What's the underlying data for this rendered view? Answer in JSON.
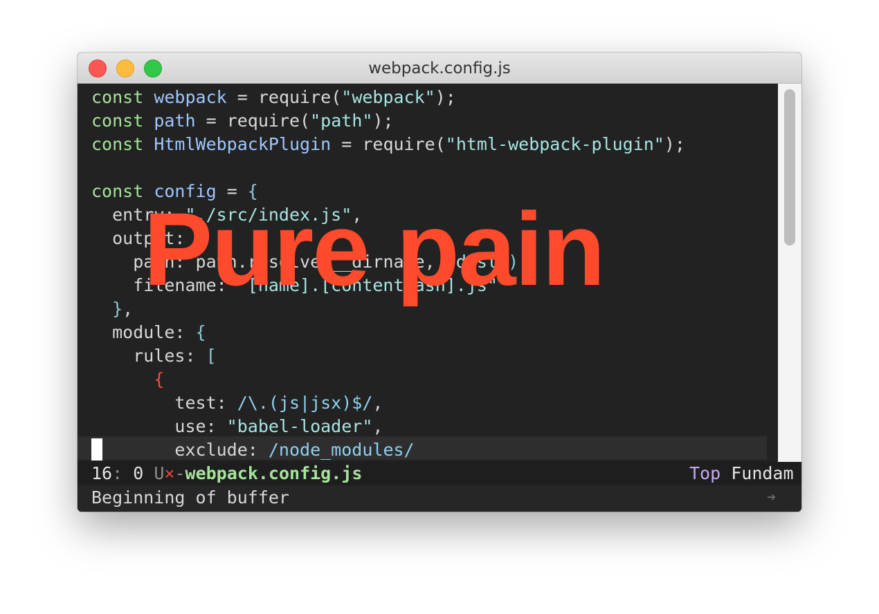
{
  "window": {
    "title": "webpack.config.js"
  },
  "editor": {
    "lines": [
      [
        {
          "t": "const",
          "c": "kw"
        },
        {
          "t": " "
        },
        {
          "t": "webpack",
          "c": "var"
        },
        {
          "t": " = require("
        },
        {
          "t": "\"webpack\"",
          "c": "str"
        },
        {
          "t": ");"
        }
      ],
      [
        {
          "t": "const",
          "c": "kw"
        },
        {
          "t": " "
        },
        {
          "t": "path",
          "c": "var"
        },
        {
          "t": " = require("
        },
        {
          "t": "\"path\"",
          "c": "str"
        },
        {
          "t": ");"
        }
      ],
      [
        {
          "t": "const",
          "c": "kw"
        },
        {
          "t": " "
        },
        {
          "t": "HtmlWebpackPlugin",
          "c": "var"
        },
        {
          "t": " = require("
        },
        {
          "t": "\"html-webpack-plugin\"",
          "c": "str"
        },
        {
          "t": ");"
        }
      ],
      [],
      [
        {
          "t": "const",
          "c": "kw"
        },
        {
          "t": " "
        },
        {
          "t": "config",
          "c": "var"
        },
        {
          "t": " = "
        },
        {
          "t": "{",
          "c": "br"
        }
      ],
      [
        {
          "t": "  entry: "
        },
        {
          "t": "\"./src/index.js\"",
          "c": "str"
        },
        {
          "t": ","
        }
      ],
      [
        {
          "t": "  output: "
        },
        {
          "t": "{",
          "c": "br"
        }
      ],
      [
        {
          "t": "    path: path.resolve"
        },
        {
          "t": "(",
          "c": "br"
        },
        {
          "t": "__dirname, "
        },
        {
          "t": "\"dist\"",
          "c": "str"
        },
        {
          "t": ")",
          "c": "br"
        },
        {
          "t": ","
        }
      ],
      [
        {
          "t": "    filename: "
        },
        {
          "t": "\"[name].[contenthash].js\"",
          "c": "str"
        }
      ],
      [
        {
          "t": "  "
        },
        {
          "t": "}",
          "c": "br"
        },
        {
          "t": ","
        }
      ],
      [
        {
          "t": "  module: "
        },
        {
          "t": "{",
          "c": "br"
        }
      ],
      [
        {
          "t": "    rules: "
        },
        {
          "t": "[",
          "c": "br"
        }
      ],
      [
        {
          "t": "      "
        },
        {
          "t": "{",
          "c": "rb"
        }
      ],
      [
        {
          "t": "        test: "
        },
        {
          "t": "/\\.(js|jsx)$/",
          "c": "rx"
        },
        {
          "t": ","
        }
      ],
      [
        {
          "t": "        use: "
        },
        {
          "t": "\"babel-loader\"",
          "c": "str"
        },
        {
          "t": ","
        }
      ],
      [
        {
          "t": "        exclude: "
        },
        {
          "t": "/node_modules/",
          "c": "rx"
        }
      ]
    ],
    "current_line": 16
  },
  "modeline": {
    "line": "16",
    "sep": ":",
    "column": " 0",
    "encoding": " U",
    "modified": "×",
    "dash": "-",
    "buffer_name": "webpack.config.js",
    "position": "Top",
    "major_mode": "Fundam"
  },
  "echo_area": {
    "message": "Beginning of buffer",
    "continuation": "➔"
  },
  "overlay": {
    "text": "Pure pain"
  },
  "colors": {
    "overlay": "#ff4a2c",
    "keyword": "#a6e39b",
    "variable": "#9fc7ff",
    "string": "#a6e5e2"
  }
}
